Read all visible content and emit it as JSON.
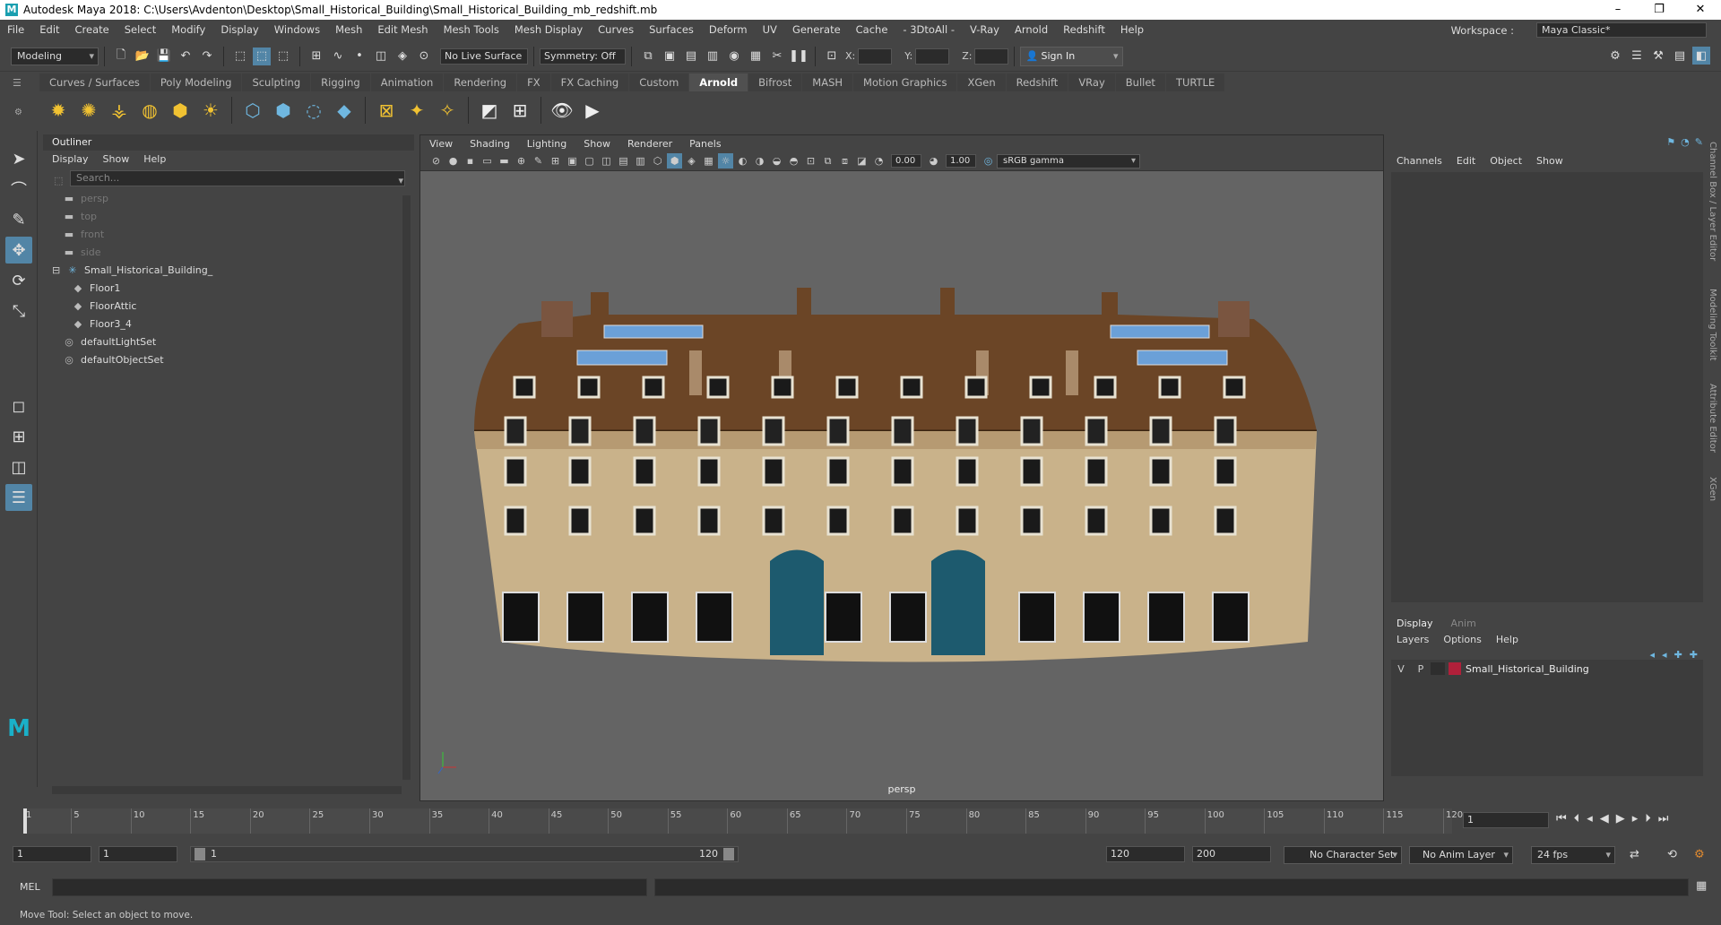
{
  "window": {
    "title": "Autodesk Maya 2018: C:\\Users\\Avdenton\\Desktop\\Small_Historical_Building\\Small_Historical_Building_mb_redshift.mb",
    "minimize": "–",
    "maximize": "❐",
    "close": "✕"
  },
  "menubar": {
    "items": [
      "File",
      "Edit",
      "Create",
      "Select",
      "Modify",
      "Display",
      "Windows",
      "Mesh",
      "Edit Mesh",
      "Mesh Tools",
      "Mesh Display",
      "Curves",
      "Surfaces",
      "Deform",
      "UV",
      "Generate",
      "Cache",
      "- 3DtoAll -",
      "V-Ray",
      "Arnold",
      "Redshift",
      "Help"
    ],
    "workspace_label": "Workspace :",
    "workspace_value": "Maya Classic*"
  },
  "statusline": {
    "mode": "Modeling",
    "live_surface": "No Live Surface",
    "symmetry": "Symmetry: Off",
    "x_label": "X:",
    "y_label": "Y:",
    "z_label": "Z:",
    "sign_in": "Sign In"
  },
  "shelf": {
    "tabs": [
      "Curves / Surfaces",
      "Poly Modeling",
      "Sculpting",
      "Rigging",
      "Animation",
      "Rendering",
      "FX",
      "FX Caching",
      "Custom",
      "Arnold",
      "Bifrost",
      "MASH",
      "Motion Graphics",
      "XGen",
      "Redshift",
      "VRay",
      "Bullet",
      "TURTLE"
    ],
    "active_tab": "Arnold"
  },
  "outliner": {
    "title": "Outliner",
    "menu": [
      "Display",
      "Show",
      "Help"
    ],
    "search_placeholder": "Search...",
    "items": [
      {
        "label": "persp",
        "dim": true
      },
      {
        "label": "top",
        "dim": true
      },
      {
        "label": "front",
        "dim": true
      },
      {
        "label": "side",
        "dim": true
      },
      {
        "label": "Small_Historical_Building_",
        "dim": false
      },
      {
        "label": "Floor1",
        "dim": false
      },
      {
        "label": "FloorAttic",
        "dim": false
      },
      {
        "label": "Floor3_4",
        "dim": false
      },
      {
        "label": "defaultLightSet",
        "dim": false
      },
      {
        "label": "defaultObjectSet",
        "dim": false
      }
    ]
  },
  "viewport": {
    "menu": [
      "View",
      "Shading",
      "Lighting",
      "Show",
      "Renderer",
      "Panels"
    ],
    "exposure": "0.00",
    "gamma": "1.00",
    "colorspace": "sRGB gamma",
    "camera_label": "persp"
  },
  "channelbox": {
    "menu": [
      "Channels",
      "Edit",
      "Object",
      "Show"
    ],
    "layer_tabs": [
      "Display",
      "Anim"
    ],
    "layer_menu": [
      "Layers",
      "Options",
      "Help"
    ],
    "layer": {
      "v": "V",
      "p": "P",
      "name": "Small_Historical_Building",
      "color": "#b0203a"
    }
  },
  "side_tabs": [
    "Channel Box / Layer Editor",
    "Modeling Toolkit",
    "Attribute Editor",
    "XGen"
  ],
  "timeline": {
    "ticks": [
      "1",
      "5",
      "10",
      "15",
      "20",
      "25",
      "30",
      "35",
      "40",
      "45",
      "50",
      "55",
      "60",
      "65",
      "70",
      "75",
      "80",
      "85",
      "90",
      "95",
      "100",
      "105",
      "110",
      "115",
      "120"
    ],
    "current_frame": "1"
  },
  "range": {
    "start": "1",
    "playback_start": "1",
    "slider_start": "1",
    "slider_end": "120",
    "playback_end": "120",
    "end": "200",
    "character_set": "No Character Set",
    "anim_layer": "No Anim Layer",
    "fps": "24 fps"
  },
  "cmdline": {
    "label": "MEL"
  },
  "helpline": {
    "text": "Move Tool: Select an object to move."
  },
  "colors": {
    "accent": "#5285a6",
    "roof": "#6b4526",
    "facade": "#c9b28a",
    "door": "#1d5a6e"
  }
}
